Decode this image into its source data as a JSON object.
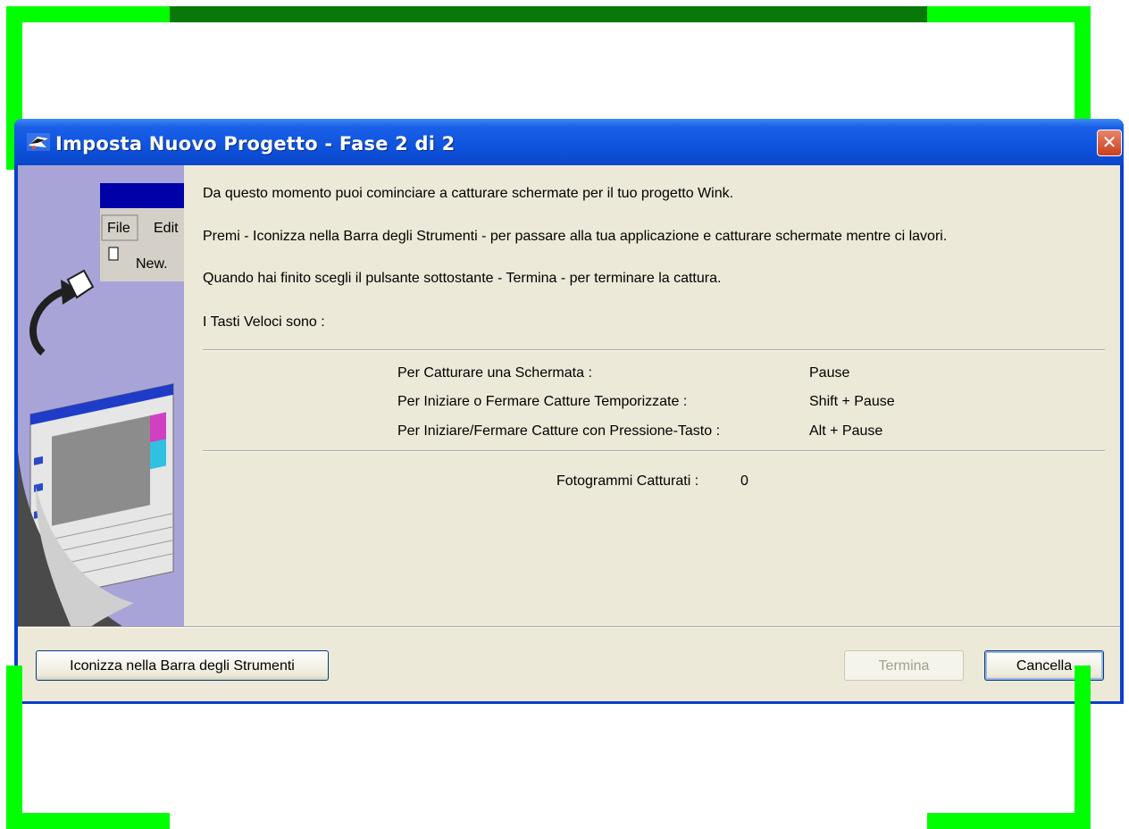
{
  "window": {
    "title": "Imposta Nuovo Progetto - Fase 2 di 2",
    "close_glyph": "✕"
  },
  "banner": {
    "menu_file": "File",
    "menu_edit": "Edit",
    "menu_new": "New."
  },
  "intro": {
    "line1": "Da questo momento puoi cominciare a catturare schermate per il tuo progetto Wink.",
    "line2": "Premi - Iconizza nella Barra degli Strumenti - per passare alla tua applicazione e catturare schermate mentre ci lavori.",
    "line3": "Quando hai finito scegli il pulsante sottostante - Termina - per terminare la cattura.",
    "line4": "I Tasti Veloci sono :"
  },
  "hotkeys": [
    {
      "action": "Per Catturare una Schermata :",
      "key": "Pause"
    },
    {
      "action": "Per Iniziare o Fermare Catture Temporizzate :",
      "key": "Shift + Pause"
    },
    {
      "action": "Per Iniziare/Fermare Catture con Pressione-Tasto :",
      "key": "Alt + Pause"
    }
  ],
  "frames": {
    "label": "Fotogrammi Catturati :",
    "count": "0"
  },
  "buttons": {
    "minimize": "Iconizza nella Barra degli Strumenti",
    "finish": "Termina",
    "cancel": "Cancella"
  },
  "colors": {
    "frame_mark": "#00ff00",
    "titlebar": "#0a46c9",
    "client_bg": "#ece9d8"
  }
}
